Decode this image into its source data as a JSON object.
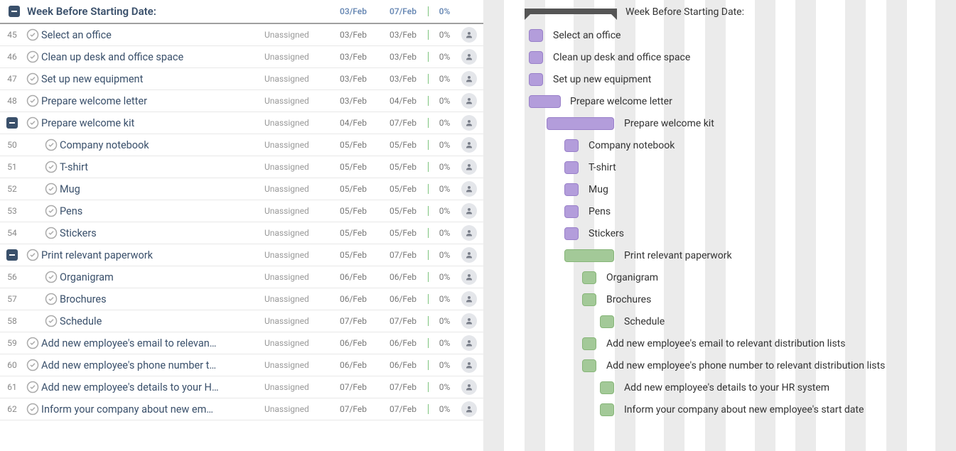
{
  "group": {
    "title": "Week Before Starting Date:",
    "start": "03/Feb",
    "end": "07/Feb",
    "pct": "0%"
  },
  "tasks": [
    {
      "num": "45",
      "name": "Select an office",
      "assignee": "Unassigned",
      "start": "03/Feb",
      "end": "03/Feb",
      "pct": "0%",
      "indent": 0,
      "collapse": false,
      "gLeft": 64,
      "gWidth": 20,
      "color": "purple",
      "labelLeft": 98
    },
    {
      "num": "46",
      "name": "Clean up desk and office space",
      "assignee": "Unassigned",
      "start": "03/Feb",
      "end": "03/Feb",
      "pct": "0%",
      "indent": 0,
      "collapse": false,
      "gLeft": 64,
      "gWidth": 20,
      "color": "purple",
      "labelLeft": 98
    },
    {
      "num": "47",
      "name": "Set up new equipment",
      "assignee": "Unassigned",
      "start": "03/Feb",
      "end": "03/Feb",
      "pct": "0%",
      "indent": 0,
      "collapse": false,
      "gLeft": 64,
      "gWidth": 20,
      "color": "purple",
      "labelLeft": 98
    },
    {
      "num": "48",
      "name": "Prepare welcome letter",
      "assignee": "Unassigned",
      "start": "03/Feb",
      "end": "04/Feb",
      "pct": "0%",
      "indent": 0,
      "collapse": false,
      "gLeft": 64,
      "gWidth": 45,
      "color": "purple",
      "labelLeft": 122
    },
    {
      "num": "",
      "name": "Prepare welcome kit",
      "assignee": "Unassigned",
      "start": "04/Feb",
      "end": "07/Feb",
      "pct": "0%",
      "indent": 0,
      "collapse": true,
      "gLeft": 89,
      "gWidth": 95,
      "color": "purple",
      "labelLeft": 198
    },
    {
      "num": "50",
      "name": "Company notebook",
      "assignee": "Unassigned",
      "start": "05/Feb",
      "end": "05/Feb",
      "pct": "0%",
      "indent": 1,
      "collapse": false,
      "gLeft": 114,
      "gWidth": 20,
      "color": "purple",
      "labelLeft": 148
    },
    {
      "num": "51",
      "name": "T-shirt",
      "assignee": "Unassigned",
      "start": "05/Feb",
      "end": "05/Feb",
      "pct": "0%",
      "indent": 1,
      "collapse": false,
      "gLeft": 114,
      "gWidth": 20,
      "color": "purple",
      "labelLeft": 148
    },
    {
      "num": "52",
      "name": "Mug",
      "assignee": "Unassigned",
      "start": "05/Feb",
      "end": "05/Feb",
      "pct": "0%",
      "indent": 1,
      "collapse": false,
      "gLeft": 114,
      "gWidth": 20,
      "color": "purple",
      "labelLeft": 148
    },
    {
      "num": "53",
      "name": "Pens",
      "assignee": "Unassigned",
      "start": "05/Feb",
      "end": "05/Feb",
      "pct": "0%",
      "indent": 1,
      "collapse": false,
      "gLeft": 114,
      "gWidth": 20,
      "color": "purple",
      "labelLeft": 148
    },
    {
      "num": "54",
      "name": "Stickers",
      "assignee": "Unassigned",
      "start": "05/Feb",
      "end": "05/Feb",
      "pct": "0%",
      "indent": 1,
      "collapse": false,
      "gLeft": 114,
      "gWidth": 20,
      "color": "purple",
      "labelLeft": 148
    },
    {
      "num": "",
      "name": "Print relevant paperwork",
      "assignee": "Unassigned",
      "start": "05/Feb",
      "end": "07/Feb",
      "pct": "0%",
      "indent": 0,
      "collapse": true,
      "gLeft": 114,
      "gWidth": 70,
      "color": "green",
      "labelLeft": 198
    },
    {
      "num": "56",
      "name": "Organigram",
      "assignee": "Unassigned",
      "start": "06/Feb",
      "end": "06/Feb",
      "pct": "0%",
      "indent": 1,
      "collapse": false,
      "gLeft": 139,
      "gWidth": 20,
      "color": "green",
      "labelLeft": 173
    },
    {
      "num": "57",
      "name": "Brochures",
      "assignee": "Unassigned",
      "start": "06/Feb",
      "end": "06/Feb",
      "pct": "0%",
      "indent": 1,
      "collapse": false,
      "gLeft": 139,
      "gWidth": 20,
      "color": "green",
      "labelLeft": 173
    },
    {
      "num": "58",
      "name": "Schedule",
      "assignee": "Unassigned",
      "start": "07/Feb",
      "end": "07/Feb",
      "pct": "0%",
      "indent": 1,
      "collapse": false,
      "gLeft": 164,
      "gWidth": 20,
      "color": "green",
      "labelLeft": 198
    },
    {
      "num": "59",
      "name": "Add new employee's email to relevan…",
      "assignee": "Unassigned",
      "start": "06/Feb",
      "end": "06/Feb",
      "pct": "0%",
      "indent": 0,
      "collapse": false,
      "gLeft": 139,
      "gWidth": 20,
      "color": "green",
      "labelLeft": 173,
      "ganttName": "Add new employee's email to relevant distribution lists"
    },
    {
      "num": "60",
      "name": "Add new employee's phone number t…",
      "assignee": "Unassigned",
      "start": "06/Feb",
      "end": "06/Feb",
      "pct": "0%",
      "indent": 0,
      "collapse": false,
      "gLeft": 139,
      "gWidth": 20,
      "color": "green",
      "labelLeft": 173,
      "ganttName": "Add new employee's phone number to relevant distribution lists"
    },
    {
      "num": "61",
      "name": "Add new employee's details to your H…",
      "assignee": "Unassigned",
      "start": "07/Feb",
      "end": "07/Feb",
      "pct": "0%",
      "indent": 0,
      "collapse": false,
      "gLeft": 164,
      "gWidth": 20,
      "color": "green",
      "labelLeft": 198,
      "ganttName": "Add new employee's details to your HR system"
    },
    {
      "num": "62",
      "name": "Inform your company about new em…",
      "assignee": "Unassigned",
      "start": "07/Feb",
      "end": "07/Feb",
      "pct": "0%",
      "indent": 0,
      "collapse": false,
      "gLeft": 164,
      "gWidth": 20,
      "color": "green",
      "labelLeft": 198,
      "ganttName": "Inform your company about new employee's start date"
    }
  ],
  "gantt": {
    "summaryLeft": 58,
    "summaryWidth": 130,
    "summaryLabelLeft": 200,
    "cols": 26
  }
}
